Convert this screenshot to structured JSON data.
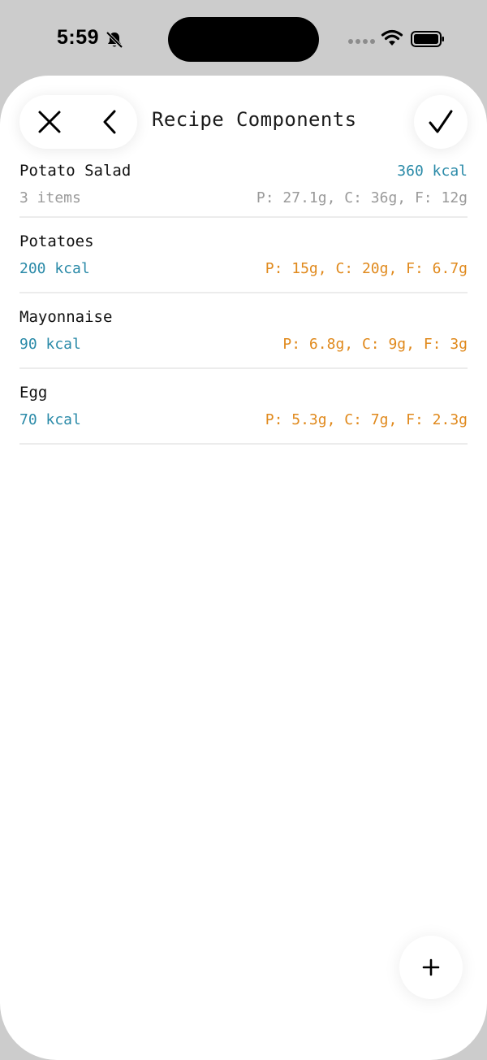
{
  "status_bar": {
    "time": "5:59",
    "icons": [
      "bell-slash-icon",
      "signal-icon",
      "wifi-icon",
      "battery-icon"
    ]
  },
  "header": {
    "title": "Recipe Components",
    "icons": [
      "close-icon",
      "chevron-left-icon",
      "checkmark-icon"
    ]
  },
  "summary": {
    "name": "Potato Salad",
    "kcal": "360 kcal",
    "count": "3 items",
    "macros": "P: 27.1g, C: 36g, F: 12g"
  },
  "components": [
    {
      "name": "Potatoes",
      "kcal": "200 kcal",
      "macros": "P: 15g, C: 20g, F: 6.7g"
    },
    {
      "name": "Mayonnaise",
      "kcal": "90 kcal",
      "macros": "P: 6.8g, C: 9g, F: 3g"
    },
    {
      "name": "Egg",
      "kcal": "70 kcal",
      "macros": "P: 5.3g, C: 7g, F: 2.3g"
    }
  ],
  "fab": {
    "icon": "plus-icon"
  },
  "colors": {
    "kcal": "#2a8aa8",
    "macros": "#e0891c",
    "muted": "#9a9a9a",
    "background": "#cccccc"
  }
}
